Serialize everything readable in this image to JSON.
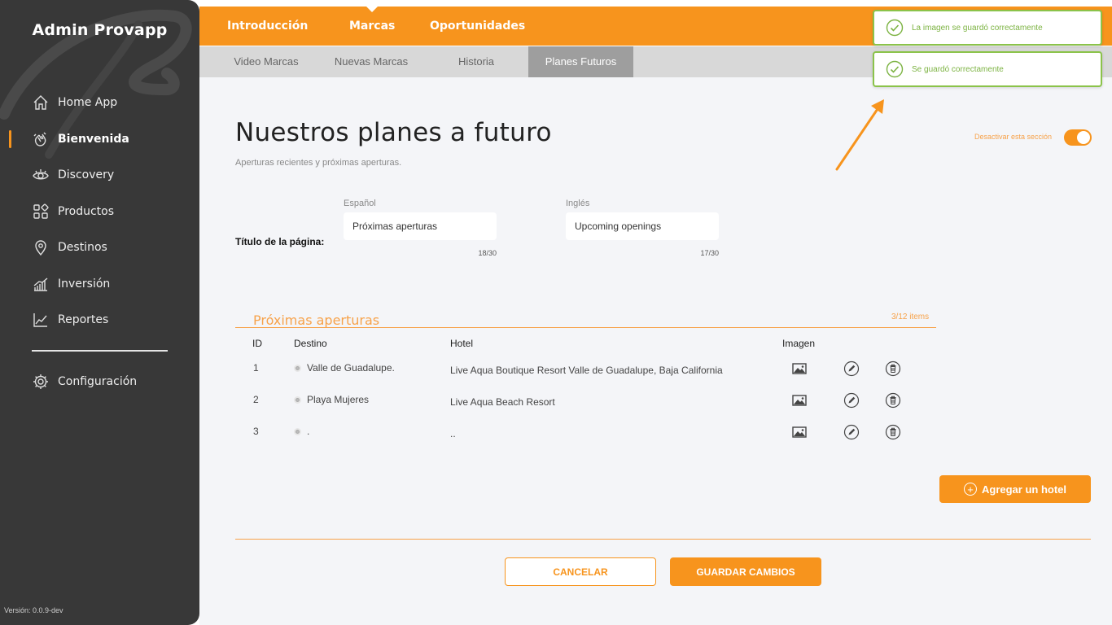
{
  "sidebar": {
    "title": "Admin Provapp",
    "items": [
      {
        "label": "Home App",
        "icon": "home-icon"
      },
      {
        "label": "Bienvenida",
        "icon": "waving-hand-icon"
      },
      {
        "label": "Discovery",
        "icon": "eye-icon"
      },
      {
        "label": "Productos",
        "icon": "grid-icon"
      },
      {
        "label": "Destinos",
        "icon": "location-pin-icon"
      },
      {
        "label": "Inversión",
        "icon": "bar-chart-icon"
      },
      {
        "label": "Reportes",
        "icon": "line-chart-icon"
      }
    ],
    "config": {
      "label": "Configuración",
      "icon": "gear-icon"
    },
    "version": "Versión: 0.0.9-dev"
  },
  "topbar": {
    "tabs": [
      "Introducción",
      "Marcas",
      "Oportunidades"
    ],
    "active": "Marcas"
  },
  "subbar": {
    "tabs": [
      "Video Marcas",
      "Nuevas Marcas",
      "Historia",
      "Planes Futuros"
    ],
    "active": "Planes Futuros"
  },
  "main": {
    "title": "Nuestros planes a futuro",
    "subtitle": "Aperturas recientes y próximas aperturas.",
    "toggle_label": "Desactivar esta sección",
    "toggle_on": true,
    "field_label": "Título de la página:",
    "spanish": {
      "lang": "Español",
      "value": "Próximas aperturas",
      "count": "18/30"
    },
    "english": {
      "lang": "Inglés",
      "value": "Upcoming openings",
      "count": "17/30"
    },
    "section_title": "Próximas aperturas",
    "section_count": "3/12 items",
    "table": {
      "headers": {
        "id": "ID",
        "destino": "Destino",
        "hotel": "Hotel",
        "imagen": "Imagen"
      },
      "rows": [
        {
          "id": "1",
          "destino": "Valle de Guadalupe.",
          "hotel": "Live Aqua Boutique Resort Valle de Guadalupe, Baja California"
        },
        {
          "id": "2",
          "destino": "Playa Mujeres",
          "hotel": "Live Aqua Beach Resort"
        },
        {
          "id": "3",
          "destino": ".",
          "hotel": ".."
        }
      ]
    },
    "add_button": "Agregar un hotel",
    "cancel_button": "CANCELAR",
    "save_button": "GUARDAR CAMBIOS"
  },
  "toasts": [
    {
      "message": "La imagen se guardó correctamente"
    },
    {
      "message": "Se guardó correctamente"
    }
  ],
  "colors": {
    "accent": "#f7941d",
    "sidebar": "#383838",
    "success": "#8bc34a"
  }
}
